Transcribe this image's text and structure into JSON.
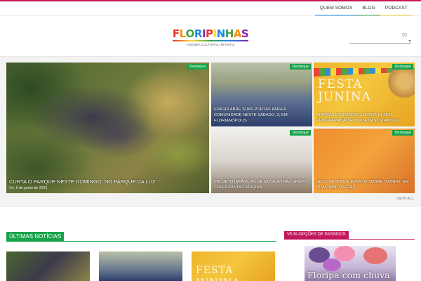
{
  "nav": {
    "items": [
      {
        "label": "QUEM SOMOS",
        "color": "#1e88e5"
      },
      {
        "label": "BLOG",
        "color": "#43a047"
      },
      {
        "label": "PODCAST",
        "color": "#fdd835"
      }
    ]
  },
  "logo": {
    "letters": [
      "F",
      "L",
      "O",
      "R",
      "I",
      "P",
      "I",
      "N",
      "H",
      "A",
      "S"
    ],
    "letter_colors": [
      "#e53935",
      "#fb8c00",
      "#43a047",
      "#1e88e5",
      "#8e24aa",
      "#e53935",
      "#fdd835",
      "#1e88e5",
      "#43a047",
      "#fb8c00",
      "#8e24aa"
    ],
    "tagline": "AGENDA CULTURAL INFANTIL"
  },
  "search": {
    "value": "20"
  },
  "featured": {
    "badge": "Destaque",
    "main": {
      "title": "CURTA O PARQUE NESTE DOMINGO, NO PARQUE DA LUZ",
      "author_prefix": "On",
      "date": "6 de junho de 2023"
    },
    "tiles": [
      {
        "title": "EPAGRI ABRE SUAS PORTAS PARA A COMUNIDADE NESTE SÁBADO, 3, EM FLORIANÓPOLIS"
      },
      {
        "title": "ARRAIÁS DO BESFEM JURERÊ IN TEM PROGRAMAÇÃO FOCADA NAS CRIANÇAS",
        "art_text": "FESTA JUNINA"
      },
      {
        "title": "PROJETO INFÂNCIAS DE MÚSICA TRAZ GRUPO CRIA A SANTA CATARINA"
      },
      {
        "title": "SESC PROMOVE EVENTO SOBRE \"SONHO\" EM SUAS BIBLIOTECAS"
      }
    ],
    "view_all": "VIEW ALL"
  },
  "sections": {
    "latest": "ÚLTIMAS NOTÍCIAS",
    "tours": "VEJA OPÇÕES DE PASSEIOS"
  },
  "tour_card": {
    "art_text": "Floripa com chuva"
  },
  "colors": {
    "accent_green": "#16a34a",
    "accent_magenta": "#c2185b"
  }
}
